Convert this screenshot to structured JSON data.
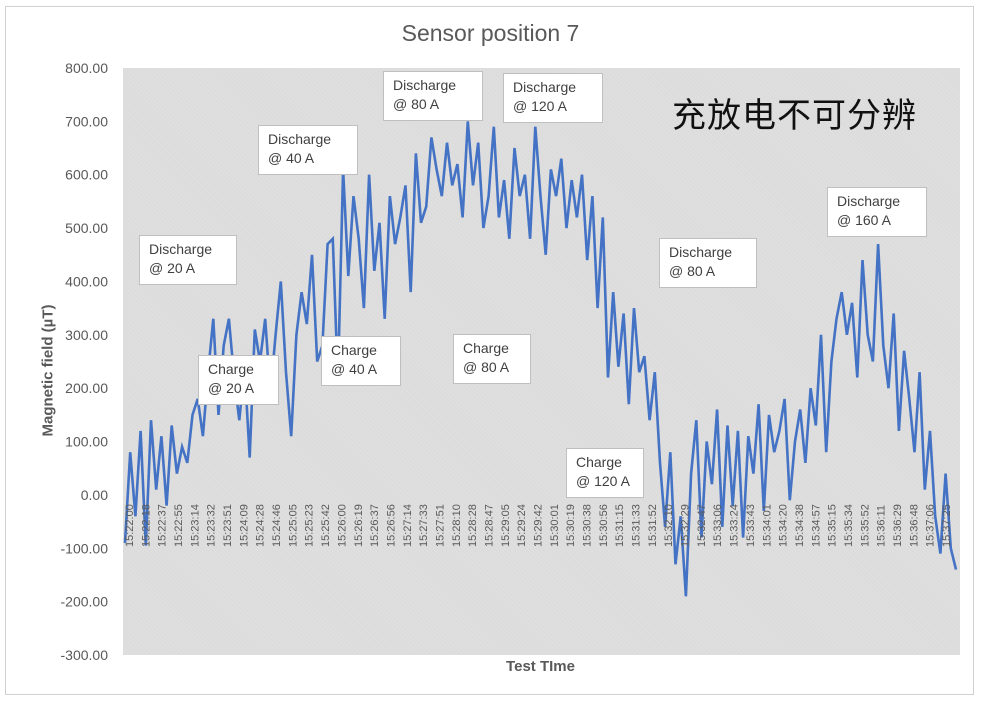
{
  "chart_data": {
    "type": "line",
    "title": "Sensor position 7",
    "xlabel": "Test TIme",
    "ylabel": "Magnetic field (µT)",
    "ylim": [
      -300,
      800
    ],
    "yticks": [
      "800.00",
      "700.00",
      "600.00",
      "500.00",
      "400.00",
      "300.00",
      "200.00",
      "100.00",
      "0.00",
      "-100.00",
      "-200.00",
      "-300.00"
    ],
    "ytick_values": [
      800,
      700,
      600,
      500,
      400,
      300,
      200,
      100,
      0,
      -100,
      -200,
      -300
    ],
    "xticks": [
      "15:22:00",
      "15:22:18",
      "15:22:37",
      "15:22:55",
      "15:23:14",
      "15:23:32",
      "15:23:51",
      "15:24:09",
      "15:24:28",
      "15:24:46",
      "15:25:05",
      "15:25:23",
      "15:25:42",
      "15:26:00",
      "15:26:19",
      "15:26:37",
      "15:26:56",
      "15:27:14",
      "15:27:33",
      "15:27:51",
      "15:28:10",
      "15:28:28",
      "15:28:47",
      "15:29:05",
      "15:29:24",
      "15:29:42",
      "15:30:01",
      "15:30:19",
      "15:30:38",
      "15:30:56",
      "15:31:15",
      "15:31:33",
      "15:31:52",
      "15:32:10",
      "15:32:29",
      "15:32:47",
      "15:33:06",
      "15:33:24",
      "15:33:43",
      "15:34:01",
      "15:34:20",
      "15:34:38",
      "15:34:57",
      "15:35:15",
      "15:35:34",
      "15:35:52",
      "15:36:11",
      "15:36:29",
      "15:36:48",
      "15:37:06",
      "15:37:25"
    ],
    "grid": false,
    "legend": "none",
    "series": [
      {
        "name": "Magnetic field",
        "color": "#4472c4",
        "x_index_range": [
          0,
          50.5
        ],
        "values": [
          -90,
          80,
          -40,
          120,
          -95,
          140,
          10,
          110,
          -20,
          130,
          40,
          90,
          60,
          150,
          180,
          110,
          230,
          330,
          150,
          280,
          330,
          220,
          140,
          240,
          70,
          310,
          250,
          330,
          190,
          300,
          400,
          230,
          110,
          300,
          380,
          320,
          450,
          250,
          280,
          470,
          480,
          210,
          610,
          410,
          560,
          480,
          350,
          600,
          420,
          510,
          330,
          560,
          470,
          520,
          580,
          380,
          640,
          510,
          540,
          670,
          610,
          560,
          660,
          580,
          620,
          520,
          700,
          580,
          660,
          500,
          560,
          690,
          520,
          590,
          480,
          650,
          560,
          600,
          480,
          690,
          560,
          450,
          610,
          560,
          630,
          500,
          590,
          520,
          600,
          440,
          560,
          350,
          520,
          220,
          380,
          240,
          340,
          170,
          350,
          230,
          260,
          140,
          230,
          60,
          -60,
          80,
          -130,
          -40,
          -190,
          40,
          140,
          -80,
          100,
          20,
          160,
          -60,
          130,
          -20,
          120,
          -80,
          110,
          40,
          170,
          -30,
          150,
          80,
          120,
          180,
          -10,
          100,
          160,
          60,
          200,
          130,
          300,
          80,
          250,
          330,
          380,
          300,
          360,
          220,
          440,
          300,
          250,
          470,
          280,
          200,
          340,
          120,
          270,
          180,
          80,
          230,
          10,
          120,
          -40,
          -110,
          40,
          -100,
          -140
        ]
      }
    ],
    "annotations": [
      {
        "line1": "Discharge",
        "line2": "@ 20 A"
      },
      {
        "line1": "Charge",
        "line2": "@ 20 A"
      },
      {
        "line1": "Discharge",
        "line2": "@ 40 A"
      },
      {
        "line1": "Charge",
        "line2": "@ 40 A"
      },
      {
        "line1": "Discharge",
        "line2": "@ 80 A"
      },
      {
        "line1": "Discharge",
        "line2": "@ 120 A"
      },
      {
        "line1": "Charge",
        "line2": "@ 80 A"
      },
      {
        "line1": "Charge",
        "line2": "@ 120 A"
      },
      {
        "line1": "Discharge",
        "line2": "@ 80 A"
      },
      {
        "line1": "Discharge",
        "line2": "@ 160 A"
      }
    ],
    "note": "充放电不可分辨"
  }
}
